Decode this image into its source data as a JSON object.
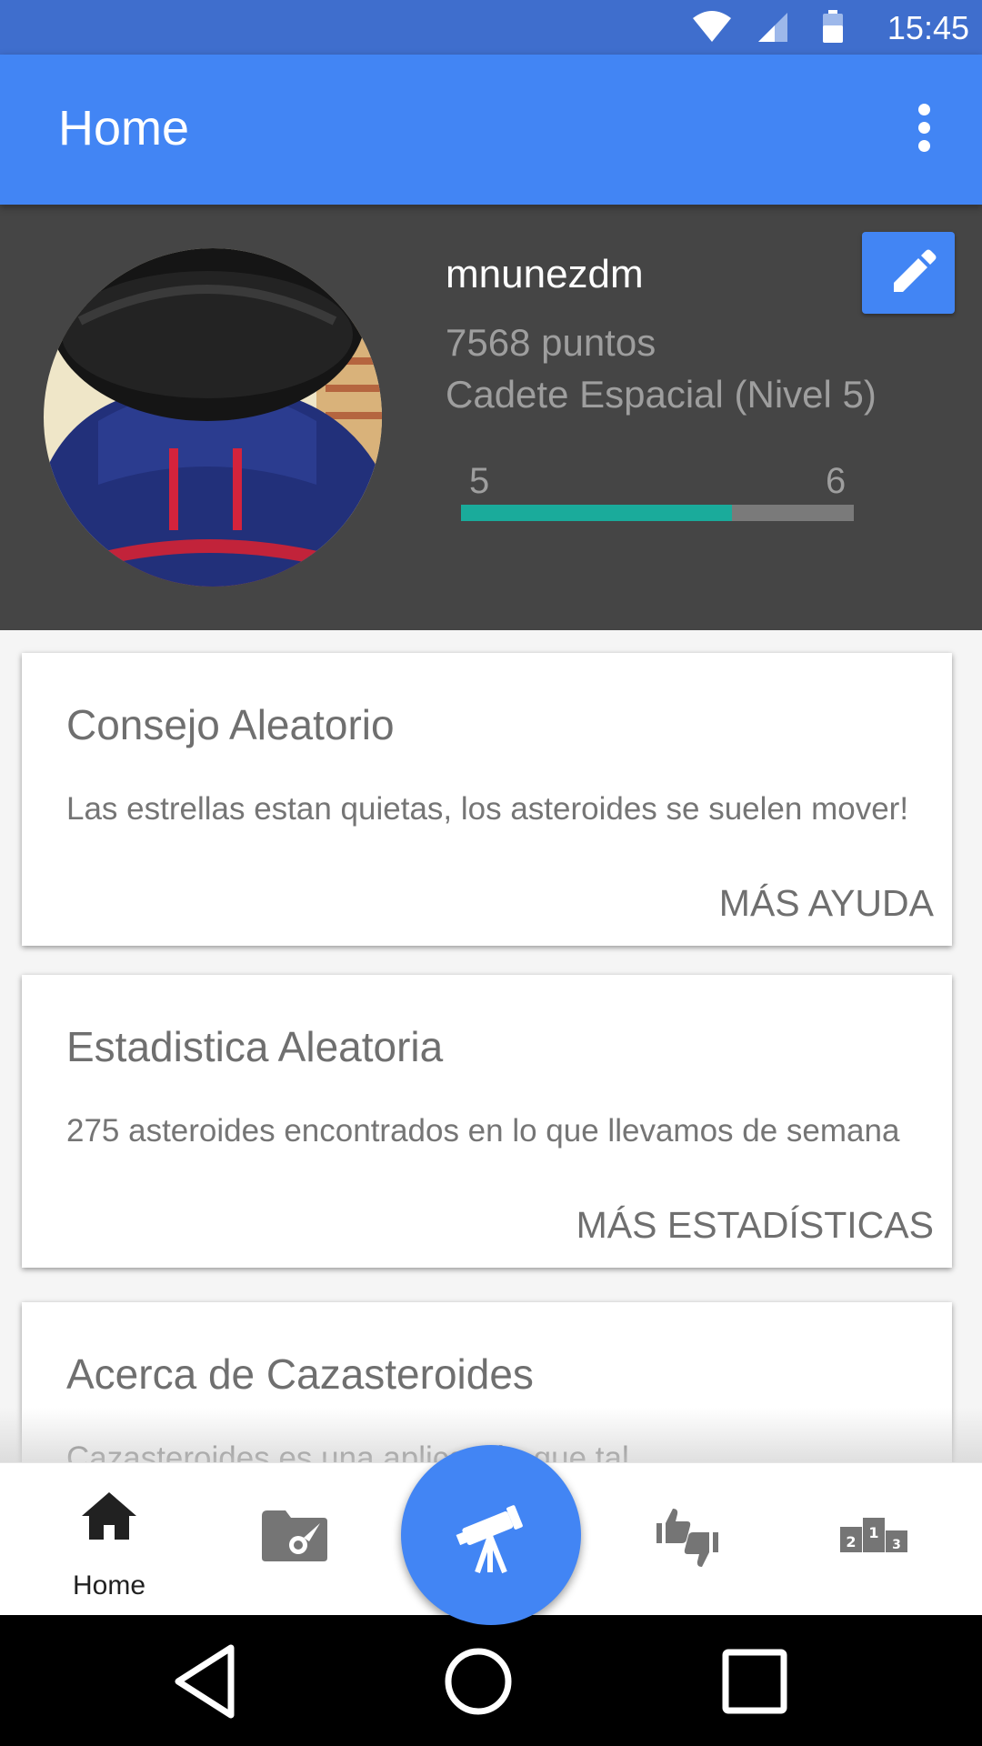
{
  "status_bar": {
    "time": "15:45",
    "icons": [
      "wifi-icon",
      "cell-signal-icon",
      "battery-icon"
    ]
  },
  "app_bar": {
    "title": "Home",
    "menu_icon": "more-vert-icon"
  },
  "profile": {
    "username": "mnunezdm",
    "points": "7568 puntos",
    "rank": "Cadete Espacial (Nivel 5)",
    "level_from": "5",
    "level_to": "6",
    "level_progress": 0.69,
    "edit_icon": "pencil-icon"
  },
  "cards": [
    {
      "title": "Consejo Aleatorio",
      "text": "Las estrellas estan quietas, los asteroides se suelen mover!",
      "action": "MÁS AYUDA"
    },
    {
      "title": "Estadistica Aleatoria",
      "text": "275 asteroides encontrados en lo que llevamos de semana",
      "action": "MÁS ESTADÍSTICAS"
    },
    {
      "title": "Acerca de Cazasteroides",
      "text": "Cazasteroides es una aplicación que tal"
    }
  ],
  "bottom_nav": {
    "items": [
      {
        "icon": "home-icon",
        "label": "Home"
      },
      {
        "icon": "asteroid-folder-icon"
      },
      {
        "icon": "telescope-icon"
      },
      {
        "icon": "thumbs-up-down-icon"
      },
      {
        "icon": "podium-icon"
      }
    ]
  },
  "colors": {
    "primary": "#4285f4",
    "status_bar": "#3f6ecd",
    "profile_bg": "#454545",
    "progress": "#1aab9b"
  }
}
